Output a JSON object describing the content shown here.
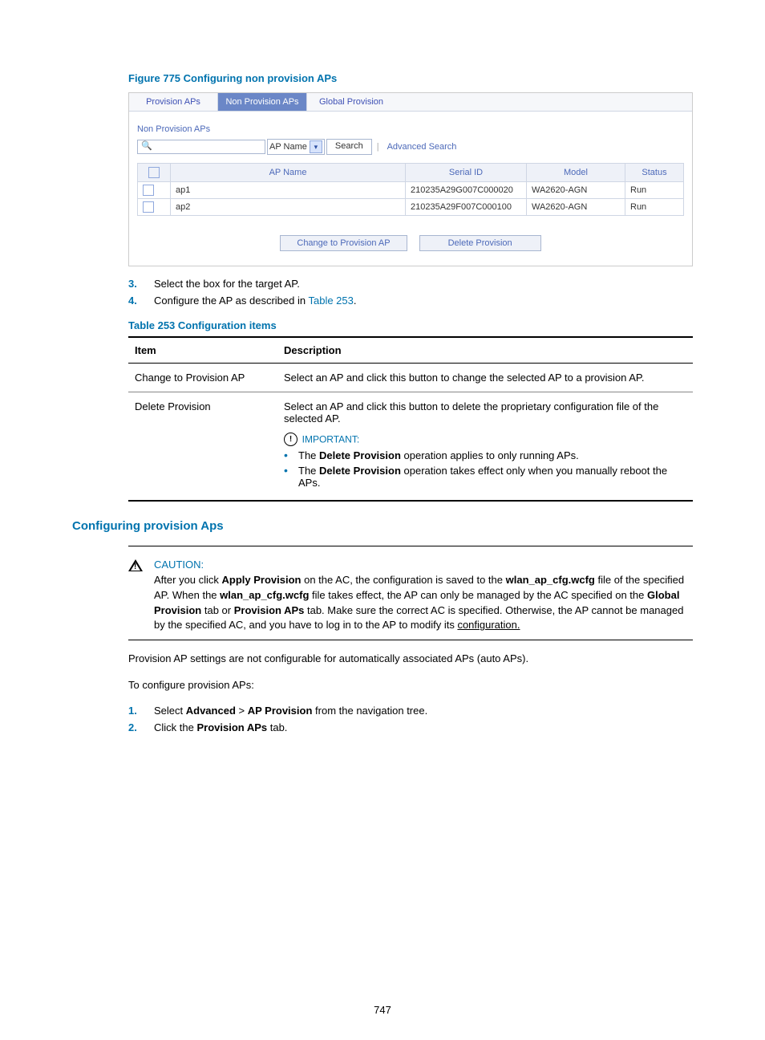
{
  "page_number": "747",
  "figure": {
    "title": "Figure 775 Configuring non provision APs",
    "tabs": [
      "Provision APs",
      "Non Provision APs",
      "Global Provision"
    ],
    "active_tab_index": 1,
    "subtitle": "Non Provision APs",
    "search_icon_glyph": "🔍",
    "select_value": "AP Name",
    "search_label": "Search",
    "advanced_search": "Advanced Search",
    "columns": [
      "AP Name",
      "Serial ID",
      "Model",
      "Status"
    ],
    "rows": [
      {
        "ap_name": "ap1",
        "serial": "210235A29G007C000020",
        "model": "WA2620-AGN",
        "status": "Run"
      },
      {
        "ap_name": "ap2",
        "serial": "210235A29F007C000100",
        "model": "WA2620-AGN",
        "status": "Run"
      }
    ],
    "action_change": "Change to Provision AP",
    "action_delete": "Delete Provision"
  },
  "steps_a": [
    {
      "num": "3.",
      "text": "Select the box for the target AP."
    },
    {
      "num": "4.",
      "prefix": "Configure the AP as described in ",
      "link": "Table 253",
      "suffix": "."
    }
  ],
  "table253": {
    "title": "Table 253 Configuration items",
    "head_item": "Item",
    "head_desc": "Description",
    "row1_item": "Change to Provision AP",
    "row1_desc": "Select an AP and click this button to change the selected AP to a provision AP.",
    "row2_item": "Delete Provision",
    "row2_desc": "Select an AP and click this button to delete the proprietary configuration file of the selected AP.",
    "important_label": "IMPORTANT:",
    "bullets": [
      {
        "pre": "The ",
        "bold": "Delete Provision",
        "post": " operation applies to only running APs."
      },
      {
        "pre": "The ",
        "bold": "Delete Provision",
        "post": " operation takes effect only when you manually reboot the APs."
      }
    ]
  },
  "section2": {
    "title": "Configuring provision Aps",
    "caution_label": "CAUTION:",
    "caution": {
      "t1": "After you click ",
      "b1": "Apply Provision",
      "t2": " on the AC, the configuration is saved to the ",
      "b2": "wlan_ap_cfg.wcfg",
      "t3": " file of the specified AP. When the ",
      "b3": "wlan_ap_cfg.wcfg",
      "t4": " file takes effect, the AP can only be managed by the AC specified on the ",
      "b4": "Global Provision",
      "t5": " tab or ",
      "b5": "Provision APs",
      "t6": " tab. Make sure the correct AC is specified. Otherwise, the AP cannot be managed by the specified AC, and you have to log in to the AP to modify its ",
      "under": "configuration."
    },
    "para1": "Provision AP settings are not configurable for automatically associated APs (auto APs).",
    "para2": "To configure provision APs:",
    "steps": [
      {
        "num": "1.",
        "pre": "Select ",
        "b1": "Advanced",
        "mid1": " > ",
        "b2": "AP Provision",
        "post": " from the navigation tree."
      },
      {
        "num": "2.",
        "pre": "Click the ",
        "b1": "Provision APs",
        "post": " tab."
      }
    ]
  }
}
